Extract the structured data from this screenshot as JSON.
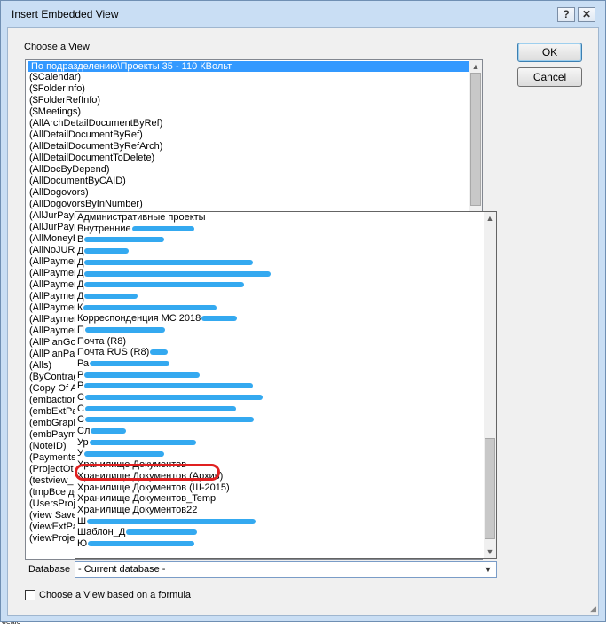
{
  "window": {
    "title": "Insert Embedded View",
    "help_glyph": "?",
    "close_glyph": "✕"
  },
  "label_choose": "Choose a View",
  "buttons": {
    "ok": "OK",
    "cancel": "Cancel"
  },
  "views_list": [
    "По подразделению\\Проекты 35 - 110 КВольт",
    "($Calendar)",
    "($FolderInfo)",
    "($FolderRefInfo)",
    "($Meetings)",
    "(AllArchDetailDocumentByRef)",
    "(AllDetailDocumentByRef)",
    "(AllDetailDocumentByRefArch)",
    "(AllDetailDocumentToDelete)",
    "(AllDocByDepend)",
    "(AllDocumentByCAID)",
    "(AllDogovors)",
    "(AllDogovorsByInNumber)",
    "(AllJurPaym",
    "(AllJurPaym",
    "(AllMoneyB",
    "(AllNoJUR)",
    "(AllPaymen",
    "(AllPaymen",
    "(AllPaymen",
    "(AllPaymen",
    "(AllPaymen",
    "(AllPaymen",
    "(AllPaymen",
    "(AllPlanGoo",
    "(AllPlanPay",
    "(Alls)",
    "(ByContrag",
    "(Copy Of Al",
    "(embaction",
    "(embExtPay",
    "(embGraph",
    "(embPayme",
    "(NoteID)",
    "(PaymentsE",
    "(ProjectOt",
    "(testview_",
    "(tmpВсе до",
    "(UsersProje",
    "(view Save",
    "(viewExtPa",
    "(viewProjec"
  ],
  "db_list": [
    {
      "text": "Административные проекты",
      "scribble": 0
    },
    {
      "text": "Внутренние",
      "scribble": 70
    },
    {
      "text": "В",
      "scribble": 90
    },
    {
      "text": "Д",
      "scribble": 50
    },
    {
      "text": "Д",
      "scribble": 190
    },
    {
      "text": "Д",
      "scribble": 210
    },
    {
      "text": "Д",
      "scribble": 180
    },
    {
      "text": "Д",
      "scribble": 60
    },
    {
      "text": "К",
      "scribble": 150
    },
    {
      "text": "Корреспонденция МС 2018",
      "scribble": 40
    },
    {
      "text": "П",
      "scribble": 90
    },
    {
      "text": "Почта (R8)",
      "scribble": 0
    },
    {
      "text": "Почта RUS (R8)",
      "scribble": 20
    },
    {
      "text": "Ра",
      "scribble": 90
    },
    {
      "text": "Р",
      "scribble": 130
    },
    {
      "text": "Р",
      "scribble": 190
    },
    {
      "text": "С",
      "scribble": 200
    },
    {
      "text": "С",
      "scribble": 170
    },
    {
      "text": "С",
      "scribble": 190
    },
    {
      "text": "Сл",
      "scribble": 40
    },
    {
      "text": "Ур",
      "scribble": 120
    },
    {
      "text": "У",
      "scribble": 90
    },
    {
      "text": "Хранилище Документов",
      "scribble": 0
    },
    {
      "text": "Хранилище Документов (Архив)",
      "scribble": 0
    },
    {
      "text": "Хранилище Документов (Ш-2015)",
      "scribble": 0
    },
    {
      "text": "Хранилище Документов_Temp",
      "scribble": 0
    },
    {
      "text": "Хранилище Документов22",
      "scribble": 0
    },
    {
      "text": "Ш",
      "scribble": 190
    },
    {
      "text": "Шаблон_Д",
      "scribble": 80
    },
    {
      "text": "Ю",
      "scribble": 120
    }
  ],
  "database_label": "Database",
  "database_value": "- Current database -",
  "formula_checkbox_label": "Choose a View based on a formula",
  "outside_text": "ecalc",
  "colors": {
    "selection": "#3399ff",
    "frame": "#c9def4",
    "scribble": "#1ea0ee",
    "highlight_ring": "#e02020"
  },
  "icons": {
    "help": "help-icon",
    "close": "close-icon",
    "scroll_up": "chevron-up-icon",
    "scroll_down": "chevron-down-icon",
    "combo_arrow": "chevron-down-icon"
  }
}
